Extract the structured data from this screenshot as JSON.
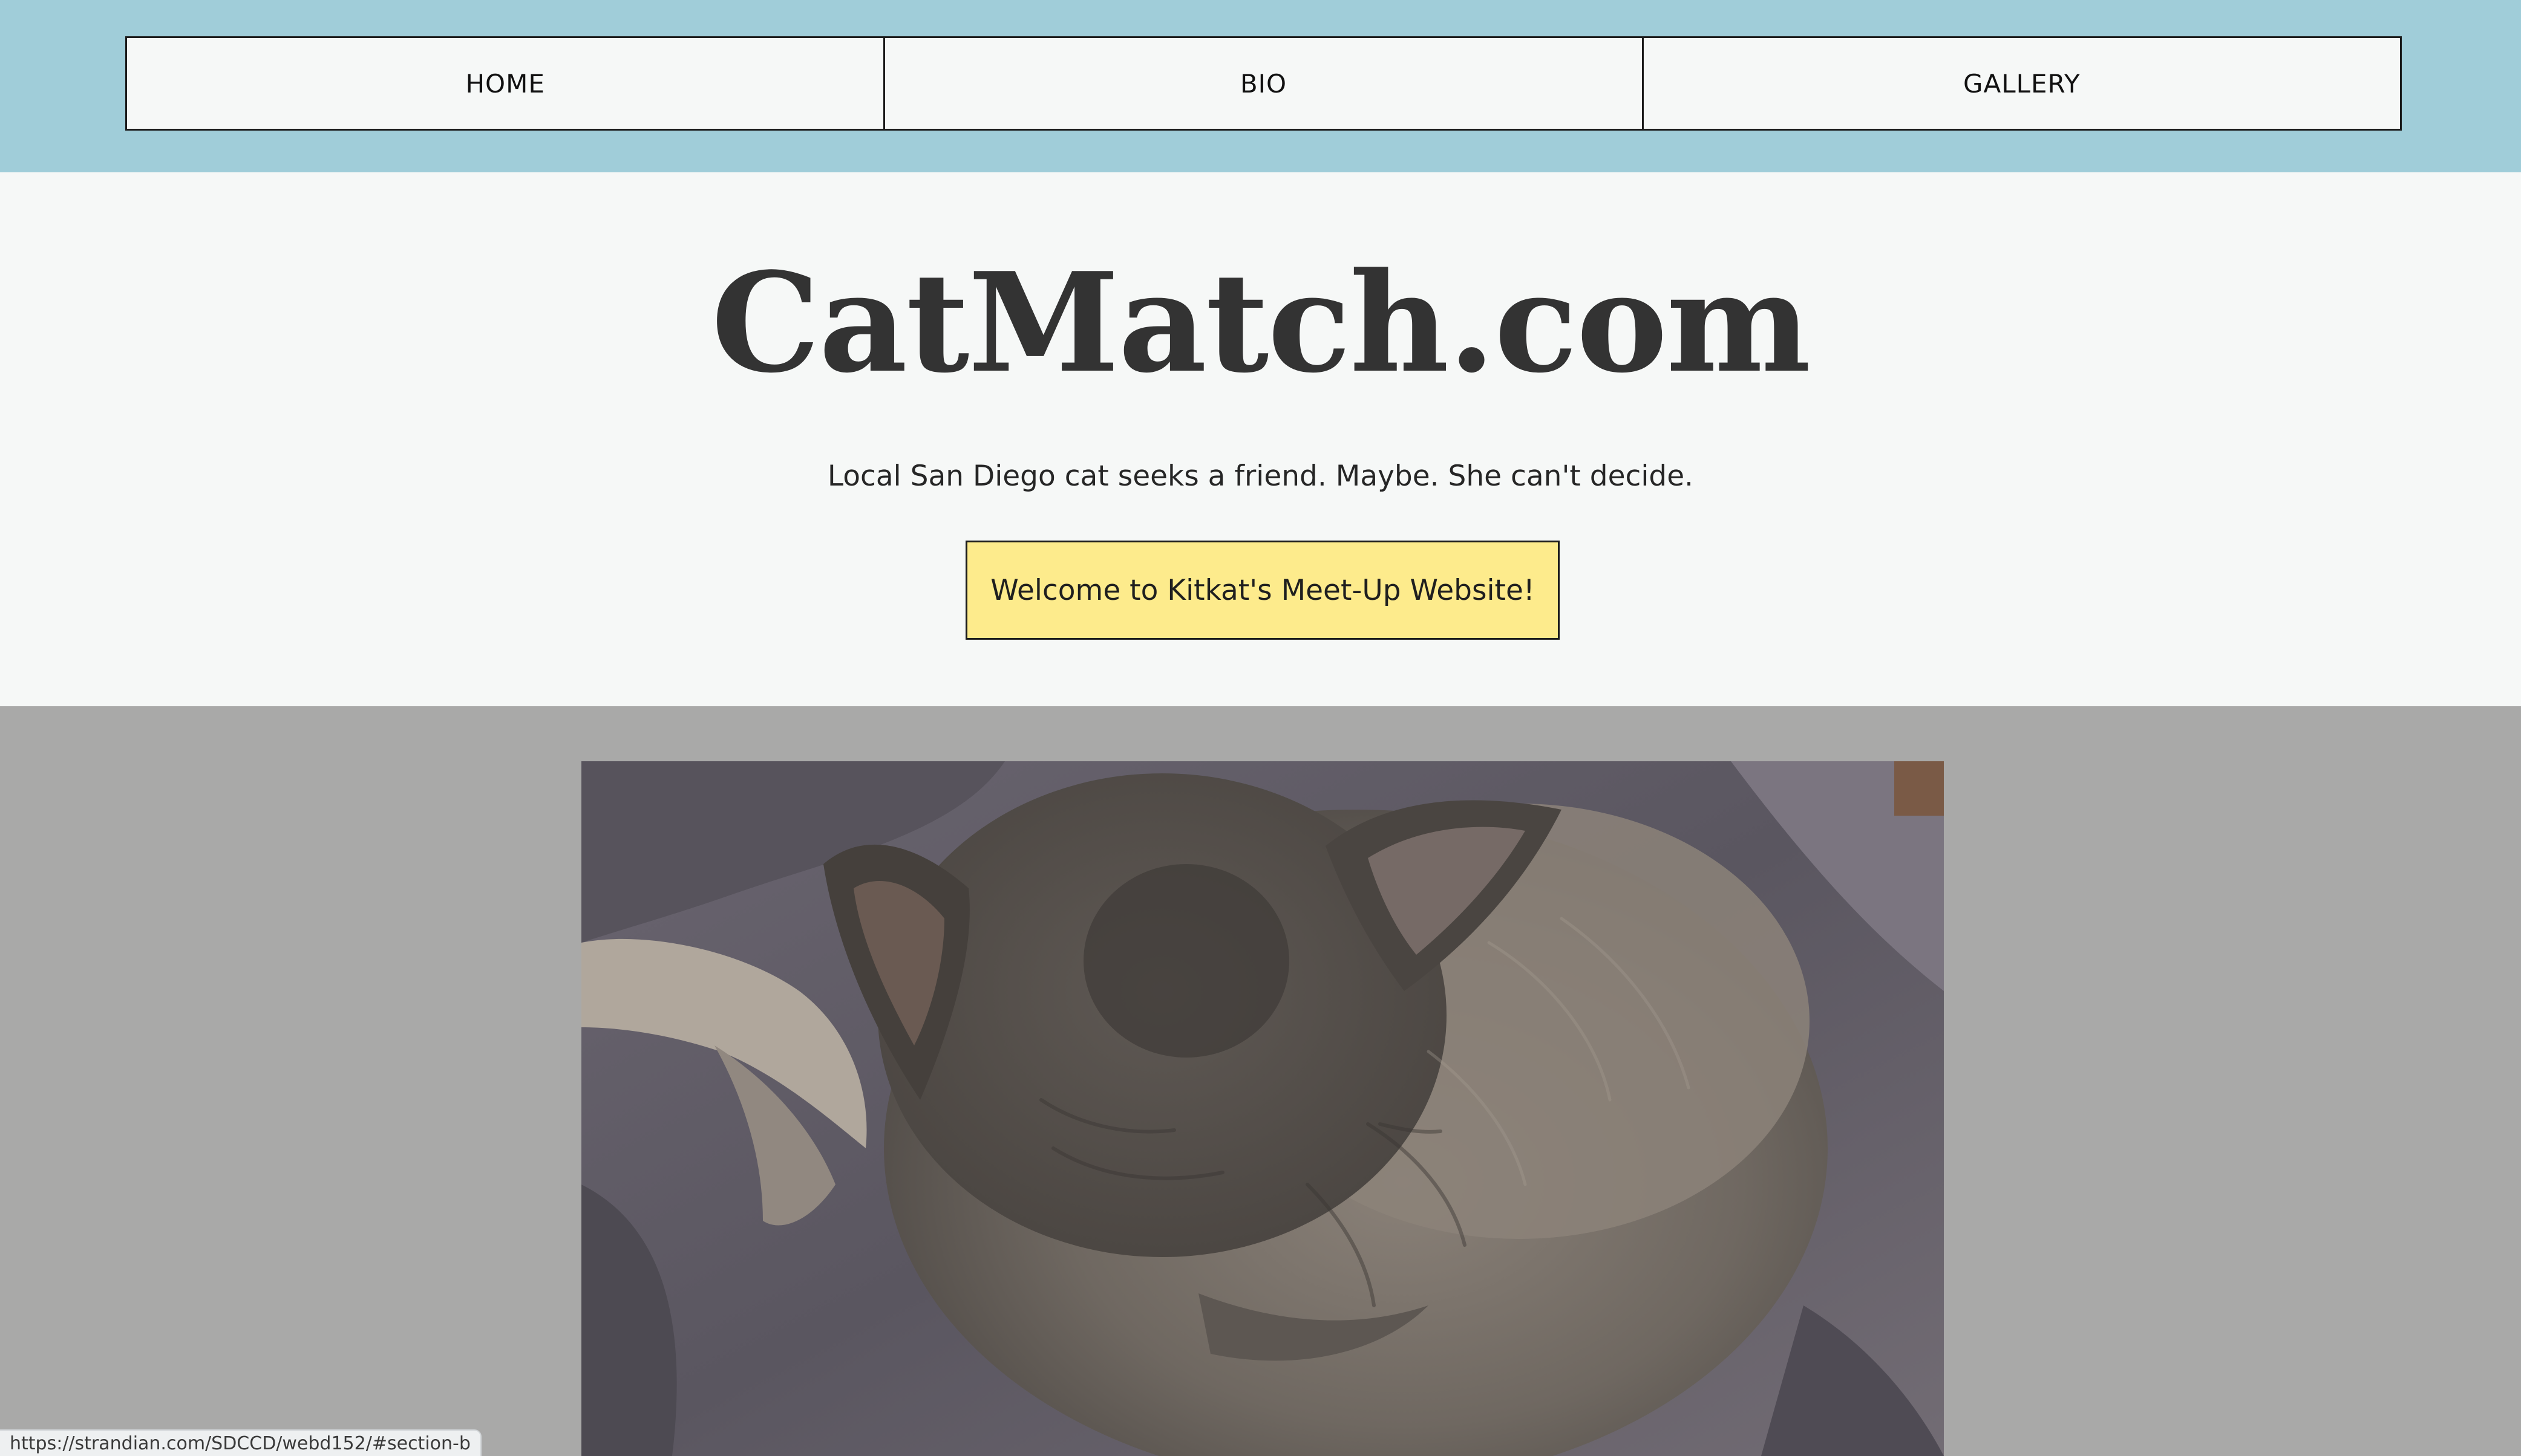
{
  "nav": {
    "items": [
      {
        "label": "HOME"
      },
      {
        "label": "BIO"
      },
      {
        "label": "GALLERY"
      }
    ]
  },
  "hero": {
    "title": "CatMatch.com",
    "tagline": "Local San Diego cat seeks a friend. Maybe. She can't decide.",
    "button_label": "Welcome to Kitkat's Meet-Up Website!"
  },
  "photo": {
    "subject": "gray cat curled up on a fluffy gray blanket"
  },
  "status_bar": {
    "url": "https://strandian.com/SDCCD/webd152/#section-b"
  },
  "colors": {
    "nav_background": "#a0cdd9",
    "page_background": "#f6f8f7",
    "button_background": "#fdeb8c",
    "photo_section_background": "#a9a9a8",
    "title_text": "#333333"
  }
}
